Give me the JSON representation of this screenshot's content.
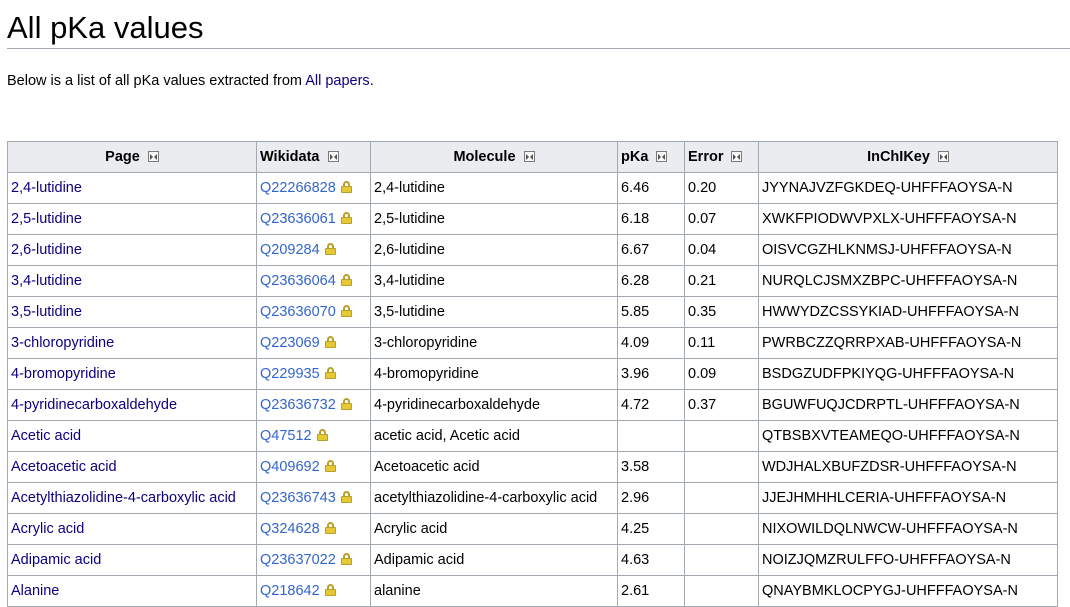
{
  "title": "All pKa values",
  "intro": {
    "prefix": "Below is a list of all pKa values extracted from ",
    "link": "All papers",
    "suffix": "."
  },
  "table": {
    "headers": [
      "Page",
      "Wikidata",
      "Molecule",
      "pKa",
      "Error",
      "InChIKey"
    ],
    "rows": [
      {
        "page": "2,4-lutidine",
        "wikidata": "Q22266828",
        "molecule": "2,4-lutidine",
        "pka": "6.46",
        "error": "0.20",
        "inchikey": "JYYNAJVZFGKDEQ-UHFFFAOYSA-N"
      },
      {
        "page": "2,5-lutidine",
        "wikidata": "Q23636061",
        "molecule": "2,5-lutidine",
        "pka": "6.18",
        "error": "0.07",
        "inchikey": "XWKFPIODWVPXLX-UHFFFAOYSA-N"
      },
      {
        "page": "2,6-lutidine",
        "wikidata": "Q209284",
        "molecule": "2,6-lutidine",
        "pka": "6.67",
        "error": "0.04",
        "inchikey": "OISVCGZHLKNMSJ-UHFFFAOYSA-N"
      },
      {
        "page": "3,4-lutidine",
        "wikidata": "Q23636064",
        "molecule": "3,4-lutidine",
        "pka": "6.28",
        "error": "0.21",
        "inchikey": "NURQLCJSMXZBPC-UHFFFAOYSA-N"
      },
      {
        "page": "3,5-lutidine",
        "wikidata": "Q23636070",
        "molecule": "3,5-lutidine",
        "pka": "5.85",
        "error": "0.35",
        "inchikey": "HWWYDZCSSYKIAD-UHFFFAOYSA-N"
      },
      {
        "page": "3-chloropyridine",
        "wikidata": "Q223069",
        "molecule": "3-chloropyridine",
        "pka": "4.09",
        "error": "0.11",
        "inchikey": "PWRBCZZQRRPXAB-UHFFFAOYSA-N"
      },
      {
        "page": "4-bromopyridine",
        "wikidata": "Q229935",
        "molecule": "4-bromopyridine",
        "pka": "3.96",
        "error": "0.09",
        "inchikey": "BSDGZUDFPKIYQG-UHFFFAOYSA-N"
      },
      {
        "page": "4-pyridinecarboxaldehyde",
        "wikidata": "Q23636732",
        "molecule": "4-pyridinecarboxaldehyde",
        "pka": "4.72",
        "error": "0.37",
        "inchikey": "BGUWFUQJCDRPTL-UHFFFAOYSA-N"
      },
      {
        "page": "Acetic acid",
        "wikidata": "Q47512",
        "molecule": "acetic acid, Acetic acid",
        "pka": "",
        "error": "",
        "inchikey": "QTBSBXVTEAMEQO-UHFFFAOYSA-N"
      },
      {
        "page": "Acetoacetic acid",
        "wikidata": "Q409692",
        "molecule": "Acetoacetic acid",
        "pka": "3.58",
        "error": "",
        "inchikey": "WDJHALXBUFZDSR-UHFFFAOYSA-N"
      },
      {
        "page": "Acetylthiazolidine-4-carboxylic acid",
        "wikidata": "Q23636743",
        "molecule": "acetylthiazolidine-4-carboxylic acid",
        "pka": "2.96",
        "error": "",
        "inchikey": "JJEJHMHHLCERIA-UHFFFAOYSA-N"
      },
      {
        "page": "Acrylic acid",
        "wikidata": "Q324628",
        "molecule": "Acrylic acid",
        "pka": "4.25",
        "error": "",
        "inchikey": "NIXOWILDQLNWCW-UHFFFAOYSA-N"
      },
      {
        "page": "Adipamic acid",
        "wikidata": "Q23637022",
        "molecule": "Adipamic acid",
        "pka": "4.63",
        "error": "",
        "inchikey": "NOIZJQMZRULFFO-UHFFFAOYSA-N"
      },
      {
        "page": "Alanine",
        "wikidata": "Q218642",
        "molecule": "alanine",
        "pka": "2.61",
        "error": "",
        "inchikey": "QNAYBMKLOCPYGJ-UHFFFAOYSA-N"
      }
    ]
  }
}
